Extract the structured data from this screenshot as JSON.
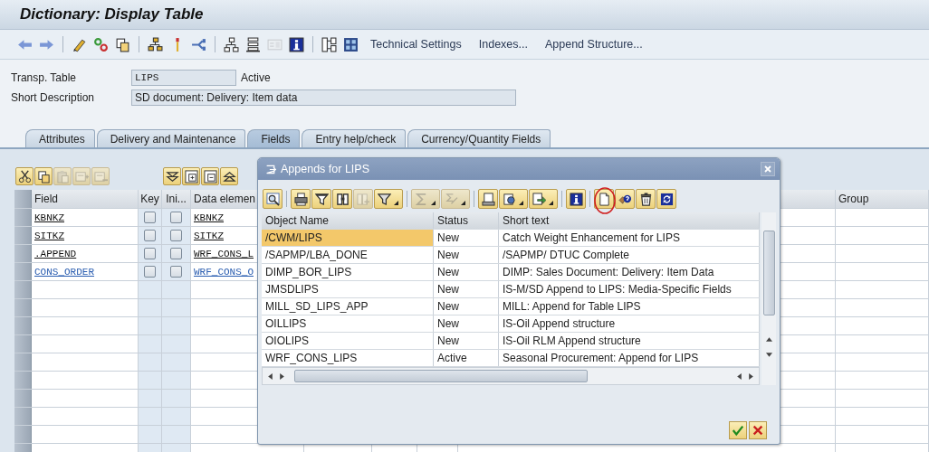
{
  "window": {
    "title": "Dictionary: Display Table"
  },
  "toolbar": {
    "icon_groups": [
      [
        {
          "kind": "back",
          "disabled": false
        },
        {
          "kind": "forward",
          "disabled": false
        }
      ],
      [
        {
          "kind": "pencil",
          "disabled": false
        },
        {
          "kind": "circles",
          "disabled": false
        },
        {
          "kind": "copy",
          "disabled": false
        }
      ],
      [
        {
          "kind": "hierarchy",
          "disabled": false
        },
        {
          "kind": "pin",
          "disabled": false
        },
        {
          "kind": "branch",
          "disabled": false
        }
      ],
      [
        {
          "kind": "tree",
          "disabled": false
        },
        {
          "kind": "stack",
          "disabled": false
        },
        {
          "kind": "panel",
          "disabled": true
        },
        {
          "kind": "info",
          "disabled": false
        }
      ],
      [
        {
          "kind": "structure",
          "disabled": false
        },
        {
          "kind": "grid",
          "disabled": false
        }
      ]
    ],
    "buttons": [
      "Technical Settings",
      "Indexes...",
      "Append Structure..."
    ]
  },
  "header": {
    "table_label": "Transp. Table",
    "table_value": "LIPS",
    "table_status": "Active",
    "description_label": "Short Description",
    "description_value": "SD document: Delivery: Item data"
  },
  "tabs": [
    {
      "label": "Attributes",
      "selected": false
    },
    {
      "label": "Delivery and Maintenance",
      "selected": false
    },
    {
      "label": "Fields",
      "selected": true
    },
    {
      "label": "Entry help/check",
      "selected": false
    },
    {
      "label": "Currency/Quantity Fields",
      "selected": false
    }
  ],
  "fields_toolbar": [
    [
      {
        "kind": "scissors",
        "disabled": false
      },
      {
        "kind": "copy",
        "disabled": false
      },
      {
        "kind": "paste",
        "disabled": true
      },
      {
        "kind": "insert-row",
        "disabled": true
      },
      {
        "kind": "delete-row",
        "disabled": true
      }
    ],
    [
      {
        "kind": "expand",
        "disabled": false
      },
      {
        "kind": "add-sub",
        "disabled": false
      },
      {
        "kind": "remove-sub",
        "disabled": false
      },
      {
        "kind": "collapse",
        "disabled": false
      }
    ]
  ],
  "fields_table": {
    "columns": {
      "field": "Field",
      "key": "Key",
      "initial": "Ini...",
      "data_element": "Data elemen",
      "group": "Group"
    },
    "rows": [
      {
        "field": "KBNKZ",
        "key": false,
        "initial": false,
        "data_element": "KBNKZ",
        "appended": false
      },
      {
        "field": "SITKZ",
        "key": false,
        "initial": false,
        "data_element": "SITKZ",
        "appended": false
      },
      {
        "field": ".APPEND",
        "key": false,
        "initial": false,
        "data_element": "WRF_CONS_L",
        "appended": false
      },
      {
        "field": "CONS_ORDER",
        "key": false,
        "initial": false,
        "data_element": "WRF_CONS_O",
        "appended": true
      }
    ]
  },
  "dialog": {
    "title": "Appends for LIPS",
    "toolbar": [
      [
        {
          "kind": "magnify",
          "disabled": false
        }
      ],
      [
        {
          "kind": "print",
          "disabled": false
        },
        {
          "kind": "funnel",
          "disabled": false
        },
        {
          "kind": "binoculars",
          "disabled": false
        },
        {
          "kind": "binoculars-plus",
          "disabled": true
        },
        {
          "kind": "filter",
          "disabled": false
        }
      ],
      [
        {
          "kind": "sum",
          "disabled": true
        },
        {
          "kind": "subtotal",
          "disabled": true
        }
      ],
      [
        {
          "kind": "document",
          "disabled": false
        },
        {
          "kind": "views",
          "disabled": false
        },
        {
          "kind": "export",
          "disabled": false
        }
      ],
      [
        {
          "kind": "info",
          "disabled": false
        }
      ],
      [
        {
          "kind": "new",
          "disabled": false
        },
        {
          "kind": "help",
          "disabled": false
        },
        {
          "kind": "delete",
          "disabled": false
        },
        {
          "kind": "refresh",
          "disabled": false
        }
      ]
    ],
    "columns": {
      "name": "Object Name",
      "status": "Status",
      "text": "Short text"
    },
    "rows": [
      {
        "name": "/CWM/LIPS",
        "status": "New",
        "text": "Catch Weight Enhancement for LIPS",
        "selected": true
      },
      {
        "name": "/SAPMP/LBA_DONE",
        "status": "New",
        "text": "/SAPMP/ DTUC Complete",
        "selected": false
      },
      {
        "name": "DIMP_BOR_LIPS",
        "status": "New",
        "text": "DIMP: Sales Document: Delivery: Item Data",
        "selected": false
      },
      {
        "name": "JMSDLIPS",
        "status": "New",
        "text": "IS-M/SD Append to LIPS: Media-Specific Fields",
        "selected": false
      },
      {
        "name": "MILL_SD_LIPS_APP",
        "status": "New",
        "text": "MILL: Append for Table LIPS",
        "selected": false
      },
      {
        "name": "OILLIPS",
        "status": "New",
        "text": "IS-Oil Append structure",
        "selected": false
      },
      {
        "name": "OIOLIPS",
        "status": "New",
        "text": "IS-Oil RLM Append structure",
        "selected": false
      },
      {
        "name": "WRF_CONS_LIPS",
        "status": "Active",
        "text": "Seasonal Procurement: Append for LIPS",
        "selected": false
      }
    ]
  }
}
